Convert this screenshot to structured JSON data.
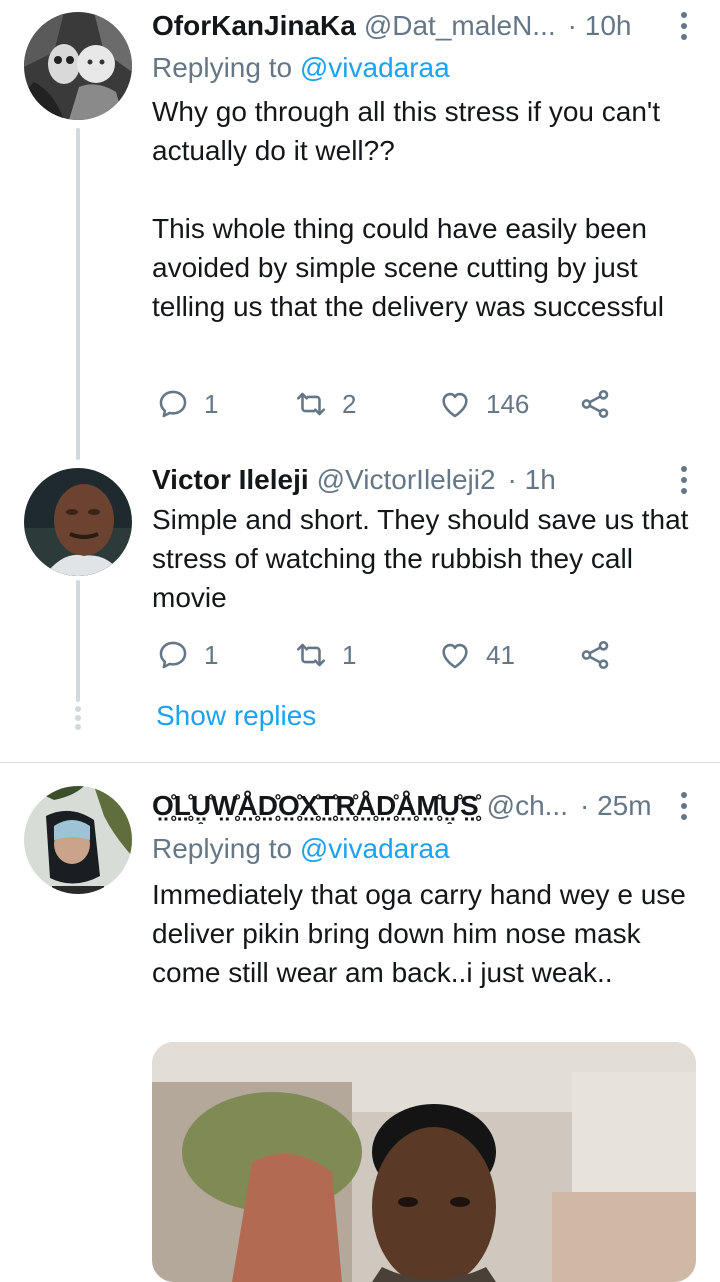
{
  "tweets": [
    {
      "name": "OforKanJinaKa",
      "handle": "@Dat_maleN...",
      "time": "· 10h",
      "reply_prefix": "Replying to ",
      "reply_handle": "@vivadaraa",
      "text": "Why go through all this stress if you can't actually do it well??\n\nThis whole thing could have easily been avoided by simple scene cutting by just telling us that the delivery was successful",
      "replies": "1",
      "retweets": "2",
      "likes": "146"
    },
    {
      "name": "Victor Ileleji",
      "handle": "@VictorIleleji2",
      "time": "· 1h",
      "text": "Simple and short. They should save us that stress of watching the rubbish they call movie",
      "replies": "1",
      "retweets": "1",
      "likes": "41"
    },
    {
      "name": "O̤̥̊L̤̥̊Ṳ̥̊W̤̥̊Å̤̥D̤̥̊O̤̥̊X̤̥̊T̤̥̊R̤̥̊Å̤̥D̤̥̊Å̤̥M̤̥̊Ṳ̥̊S̤̥̊",
      "handle": "@ch...",
      "time": "· 25m",
      "reply_prefix": "Replying to ",
      "reply_handle": "@vivadaraa",
      "text": "Immediately that oga carry hand wey e use deliver pikin bring down him nose mask come still wear am back..i just weak.."
    }
  ],
  "show_replies": "Show replies",
  "icons": {
    "reply": "reply-icon",
    "retweet": "retweet-icon",
    "like": "like-icon",
    "share": "share-icon",
    "more": "more-vertical-icon"
  },
  "colors": {
    "accent": "#1da1f2",
    "secondary_text": "#657786",
    "thread_line": "#cfd9de"
  }
}
